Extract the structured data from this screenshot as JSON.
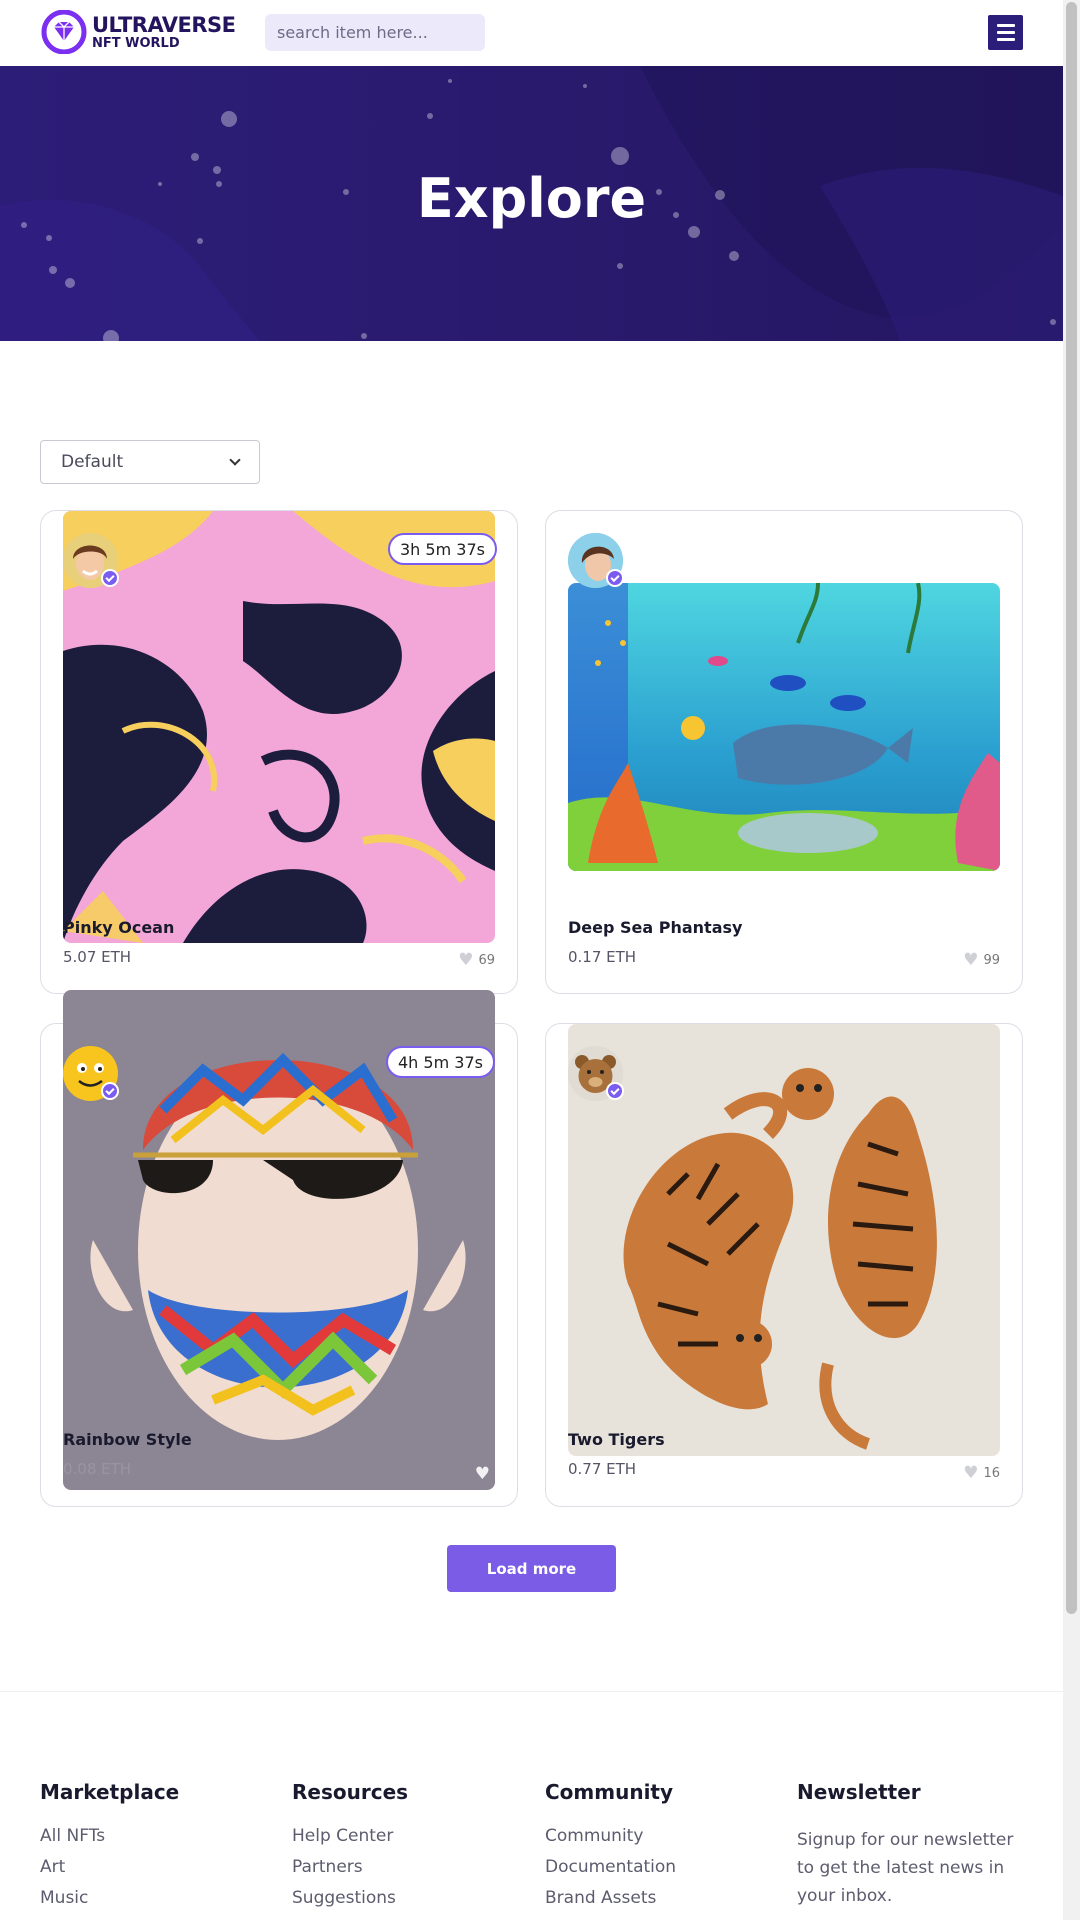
{
  "header": {
    "logo_title": "ULTRAVERSE",
    "logo_subtitle": "NFT WORLD",
    "search_placeholder": "search item here..."
  },
  "hero": {
    "title": "Explore"
  },
  "sort": {
    "selected": "Default"
  },
  "items": [
    {
      "title": "Pinky Ocean",
      "price": "5.07 ETH",
      "likes": "69",
      "timer": "3h 5m 37s",
      "avatar": "woman-avatar"
    },
    {
      "title": "Deep Sea Phantasy",
      "price": "0.17 ETH",
      "likes": "99",
      "timer": "",
      "avatar": "woman-avatar"
    },
    {
      "title": "Rainbow Style",
      "price": "0.08 ETH",
      "likes": "",
      "timer": "4h 5m 37s",
      "avatar": "smiley-avatar"
    },
    {
      "title": "Two Tigers",
      "price": "0.77 ETH",
      "likes": "16",
      "timer": "",
      "avatar": "teddy-bear-avatar"
    }
  ],
  "load_more": "Load more",
  "footer": {
    "marketplace": {
      "title": "Marketplace",
      "links": [
        "All NFTs",
        "Art",
        "Music"
      ]
    },
    "resources": {
      "title": "Resources",
      "links": [
        "Help Center",
        "Partners",
        "Suggestions"
      ]
    },
    "community": {
      "title": "Community",
      "links": [
        "Community",
        "Documentation",
        "Brand Assets"
      ]
    },
    "newsletter": {
      "title": "Newsletter",
      "text": "Signup for our newsletter to get the latest news in your inbox."
    }
  },
  "colors": {
    "accent": "#7b5ce6",
    "hero_bg": "#2b1c74",
    "brand_dark": "#24145e"
  }
}
